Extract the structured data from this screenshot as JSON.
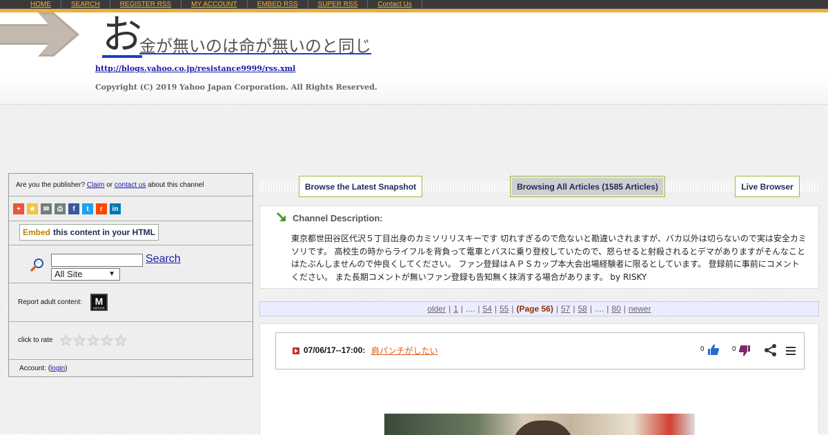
{
  "nav": {
    "items": [
      "HOME",
      "SEARCH",
      "REGISTER RSS",
      "MY ACCOUNT",
      "EMBED RSS",
      "SUPER RSS",
      "Contact Us"
    ]
  },
  "header": {
    "title_first_char": "お",
    "title_rest": "金が無いのは命が無いのと同じ",
    "rss_url": "http://blogs.yahoo.co.jp/resistance9999/rss.xml",
    "copyright": "Copyright (C) 2019 Yahoo Japan Corporation. All Rights Reserved."
  },
  "sidebar": {
    "publisher_prefix": "Are you the publisher?",
    "claim_link": "Claim",
    "or_text": "or",
    "contact_link": "contact us",
    "publisher_suffix": "about this channel",
    "embed_o": "Embed",
    "embed_rest": "this content in your HTML",
    "search_value": "",
    "search_button": "Search",
    "site_option": "All Site",
    "adult_label": "Report adult content:",
    "mature_letter": "M",
    "mature_text": "MATURE",
    "rate_label": "click to rate",
    "rating_stars": 0,
    "rating_max": 5,
    "account_prefix": "Account: (",
    "login_link": "login",
    "account_suffix": ")"
  },
  "tabs": {
    "latest": "Browse the Latest Snapshot",
    "all": "Browsing All Articles (1585 Articles)",
    "live": "Live Browser"
  },
  "channel": {
    "title": "Channel Description:",
    "text": "東京都世田谷区代沢５丁目出身のカミソリリスキーです 切れすぎるので危ないと勘違いされますが、バカ以外は切らないので実は安全カミソリです。 高校生の時からライフルを背負って電車とバスに乗り登校していたので、怒らせると射殺されるとデマがありますがそんなことはたぶんしませんので仲良くしてください。 ファン登録はＡＰＳカップ本大会出場経験者に限るとしています。 登録前に事前にコメントください。 また長期コメントが無いファン登録も告知無く抹消する場合があります。 by RISKY"
  },
  "pager": {
    "older": "older",
    "p1": "1",
    "dots1": "....",
    "p54": "54",
    "p55": "55",
    "current": "(Page 56)",
    "p57": "57",
    "p58": "58",
    "dots2": "....",
    "p80": "80",
    "newer": "newer"
  },
  "article": {
    "date": "07/06/17--17:00:",
    "title": "肩パンチがしたい",
    "up_count": "0",
    "down_count": "0"
  },
  "colors": {
    "nav_bg": "#3a3a3a",
    "accent_yellow": "#f0b030",
    "link_blue": "#1a1aaa",
    "tab_border": "#9bbb3a",
    "article_title": "#e05a10"
  }
}
